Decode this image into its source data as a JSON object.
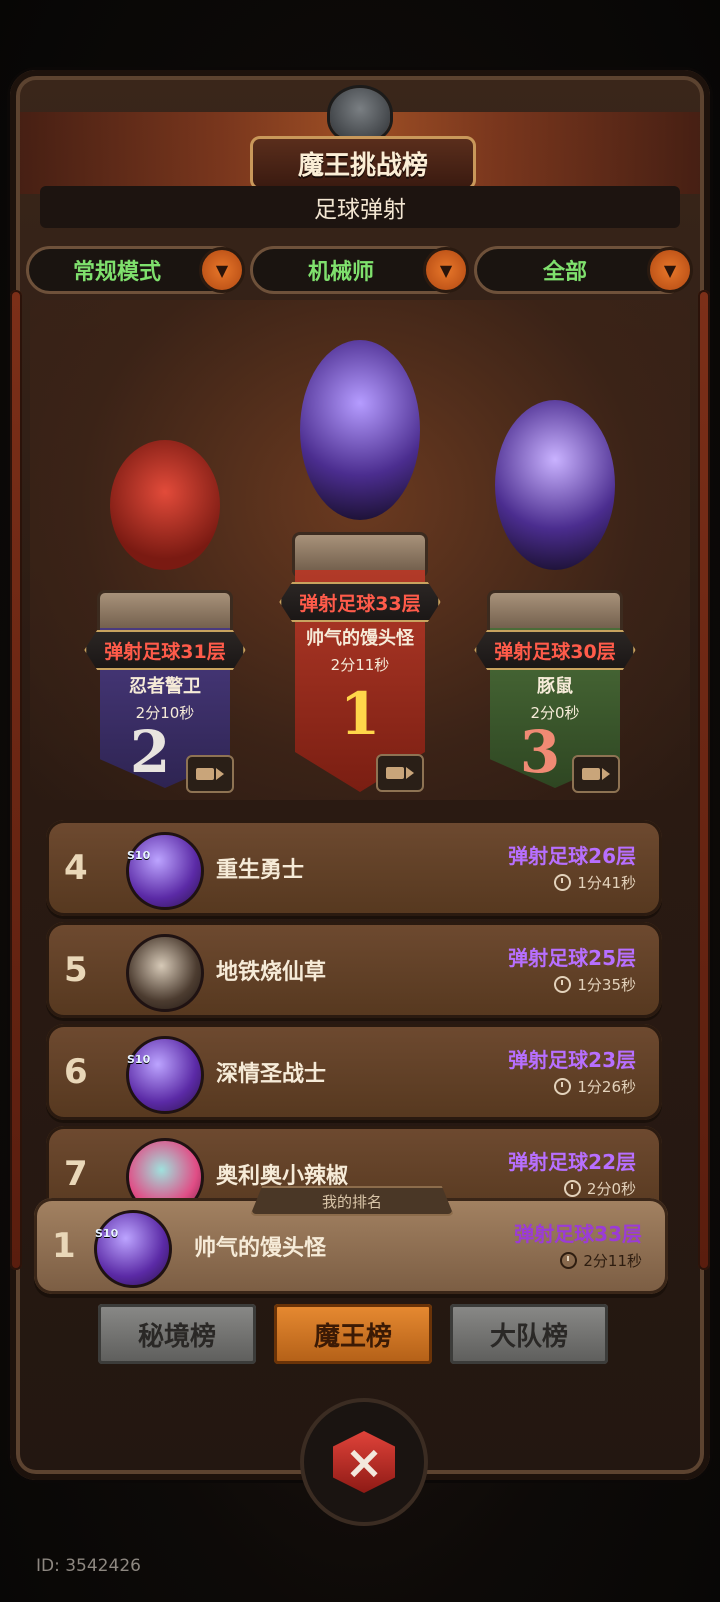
{
  "header": {
    "title": "魔王挑战榜",
    "subtitle": "足球弹射"
  },
  "filters": [
    {
      "label": "常规模式"
    },
    {
      "label": "机械师"
    },
    {
      "label": "全部"
    }
  ],
  "podium": [
    {
      "rank": "2",
      "floor": "弹射足球31层",
      "name": "忍者警卫",
      "time": "2分10秒",
      "color": "#3e2f6b"
    },
    {
      "rank": "1",
      "floor": "弹射足球33层",
      "name": "帅气的馒头怪",
      "time": "2分11秒",
      "color": "#9b2d20"
    },
    {
      "rank": "3",
      "floor": "弹射足球30层",
      "name": "豚鼠",
      "time": "2分0秒",
      "color": "#3d5a2f"
    }
  ],
  "rows": [
    {
      "rank": "4",
      "name": "重生勇士",
      "score": "弹射足球26层",
      "time": "1分41秒",
      "badge": "S10"
    },
    {
      "rank": "5",
      "name": "地铁烧仙草",
      "score": "弹射足球25层",
      "time": "1分35秒",
      "badge": ""
    },
    {
      "rank": "6",
      "name": "深情圣战士",
      "score": "弹射足球23层",
      "time": "1分26秒",
      "badge": "S10"
    },
    {
      "rank": "7",
      "name": "奥利奥小辣椒",
      "score": "弹射足球22层",
      "time": "2分0秒",
      "badge": ""
    }
  ],
  "my_rank": {
    "label": "我的排名",
    "rank": "1",
    "name": "帅气的馒头怪",
    "score": "弹射足球33层",
    "time": "2分11秒",
    "badge": "S10"
  },
  "tabs": [
    {
      "label": "秘境榜",
      "active": false
    },
    {
      "label": "魔王榜",
      "active": true
    },
    {
      "label": "大队榜",
      "active": false
    }
  ],
  "footer": {
    "id": "ID: 3542426"
  },
  "colors": {
    "score": "#b76fff",
    "filter_text": "#7fe06d",
    "rank_plate_text": "#ff5b4a",
    "tab_active": "#d87a26"
  }
}
